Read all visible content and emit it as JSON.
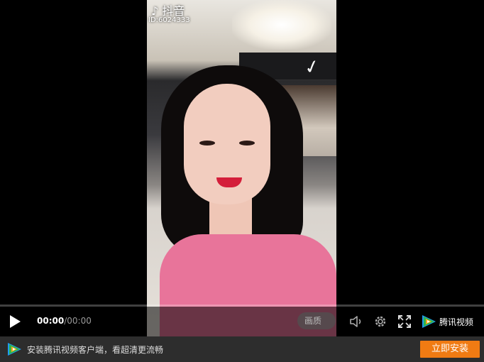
{
  "video": {
    "watermark_app": "抖音",
    "watermark_id": "ID:6024333"
  },
  "controls": {
    "current_time": "00:00",
    "separator": "/",
    "duration": "00:00",
    "quality_label": "画质",
    "brand_label": "腾讯视频",
    "progress": 0
  },
  "icons": {
    "play": "play-icon",
    "volume": "volume-icon",
    "settings": "gear-icon",
    "fullscreen": "fullscreen-icon",
    "brand": "tencent-video-logo-icon"
  },
  "banner": {
    "text": "安装腾讯视频客户端，看超清更流畅",
    "install_label": "立即安装"
  },
  "colors": {
    "install_button": "#f07b13",
    "banner_bg": "#2d2d2d",
    "logo_green": "#2fb54a",
    "logo_blue": "#1e9bf0",
    "logo_orange": "#f5a623"
  }
}
